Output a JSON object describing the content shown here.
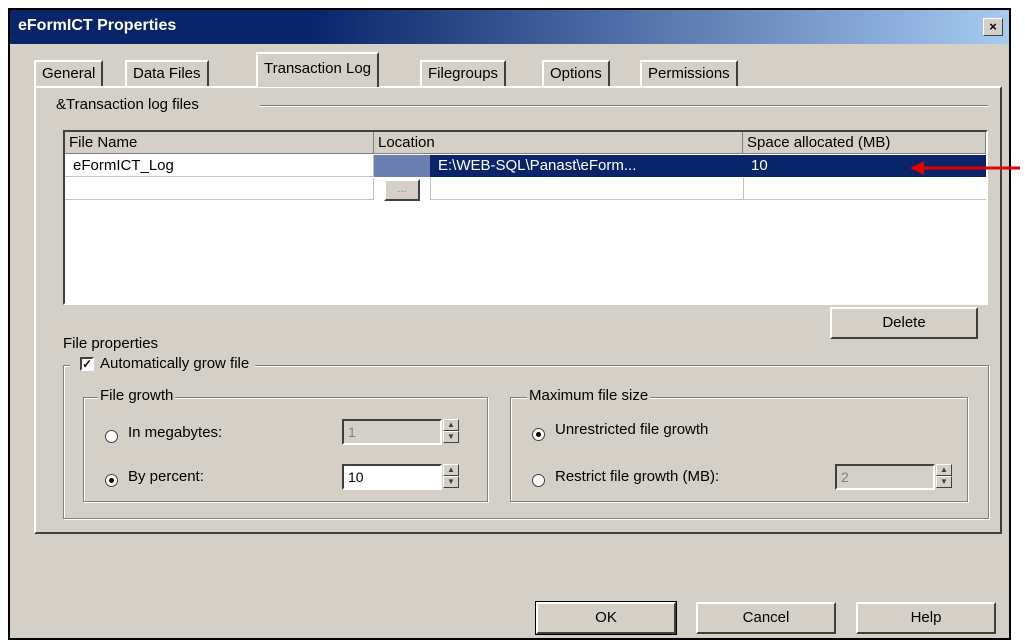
{
  "window": {
    "title": "eFormICT Properties",
    "close_glyph": "×"
  },
  "tabs": [
    {
      "label": "General"
    },
    {
      "label": "Data Files"
    },
    {
      "label": "Transaction Log"
    },
    {
      "label": "Filegroups"
    },
    {
      "label": "Options"
    },
    {
      "label": "Permissions"
    }
  ],
  "log_files": {
    "group_label": "&Transaction log files",
    "columns": [
      "File Name",
      "Location",
      "Space allocated (MB)"
    ],
    "rows": [
      {
        "file_name": "eFormICT_Log",
        "location": "E:\\WEB-SQL\\Panast\\eForm...",
        "space_mb": "10"
      }
    ],
    "browse_label": "..."
  },
  "delete_button": {
    "label": "Delete"
  },
  "file_properties": {
    "label": "File properties",
    "auto_grow_label": "Automatically grow file",
    "auto_grow_checked": true,
    "file_growth": {
      "label": "File growth",
      "in_megabytes_label": "In megabytes:",
      "in_megabytes_value": "1",
      "by_percent_label": "By percent:",
      "by_percent_value": "10",
      "selected": "by_percent"
    },
    "max_file_size": {
      "label": "Maximum file size",
      "unrestricted_label": "Unrestricted file growth",
      "restrict_label": "Restrict file growth (MB):",
      "restrict_value": "2",
      "selected": "unrestricted"
    }
  },
  "footer_buttons": {
    "ok": "OK",
    "cancel": "Cancel",
    "help": "Help"
  },
  "annotation": {
    "arrow_color": "#e00000"
  },
  "colors": {
    "selection": "#0a246a",
    "face": "#d4d0c8"
  }
}
